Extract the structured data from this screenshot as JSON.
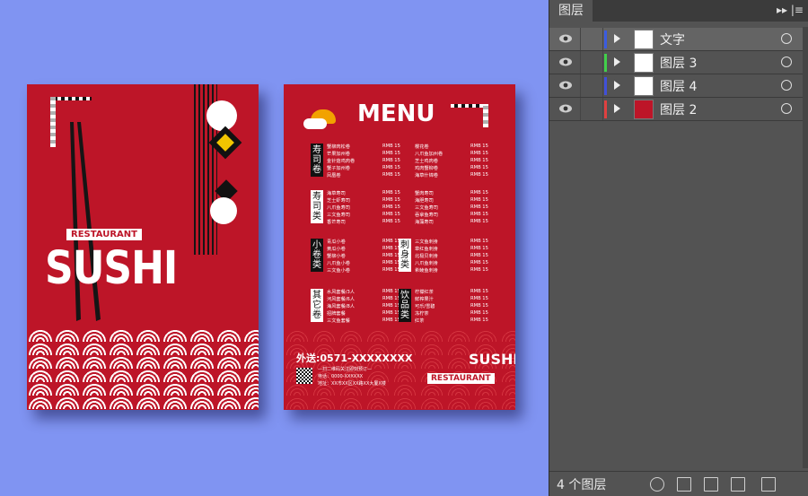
{
  "panel": {
    "tab_label": "图层",
    "menu_glyph": "▸▸ |≡",
    "layers": [
      {
        "name": "文字",
        "color": "#3a5be0",
        "selected": true
      },
      {
        "name": "图层 3",
        "color": "#42d04a",
        "selected": false
      },
      {
        "name": "图层 4",
        "color": "#4050d8",
        "selected": false
      },
      {
        "name": "图层 2",
        "color": "#e04040",
        "selected": false
      }
    ],
    "footer_count": "4 个图层",
    "footer_icons": [
      "search-icon",
      "make-clipping-mask-icon",
      "new-sublayer-icon",
      "new-layer-icon",
      "delete-icon"
    ]
  },
  "front": {
    "restaurant": "RESTAURANT",
    "sushi": "SUSHI"
  },
  "back": {
    "menu_title": "MENU",
    "categories": [
      "寿司卷",
      "寿司类",
      "小卷类",
      "其它卷",
      "刺身类",
      "饮品类"
    ],
    "col1": [
      [
        "蟹柳肉松卷",
        "RMB 15"
      ],
      [
        "芒果加州卷",
        "RMB 15"
      ],
      [
        "金针菇鸡肉卷",
        "RMB 15"
      ],
      [
        "蟹子加州卷",
        "RMB 15"
      ],
      [
        "凤凰卷",
        "RMB 15"
      ],
      [
        "海草寿司",
        "RMB 15"
      ],
      [
        "芝士虾寿司",
        "RMB 15"
      ],
      [
        "八爪鱼寿司",
        "RMB 15"
      ],
      [
        "三文鱼寿司",
        "RMB 15"
      ],
      [
        "香芒寿司",
        "RMB 15"
      ],
      [
        "青瓜小卷",
        "RMB 15"
      ],
      [
        "黄瓜小卷",
        "RMB 15"
      ],
      [
        "蟹柳小卷",
        "RMB 15"
      ],
      [
        "八爪鱼小卷",
        "RMB 15"
      ],
      [
        "三文鱼小卷",
        "RMB 15"
      ],
      [
        "水风套餐/3人",
        "RMB 15"
      ],
      [
        "河风套餐/6人",
        "RMB 15"
      ],
      [
        "海风套餐/8人",
        "RMB 15"
      ],
      [
        "招牌套餐",
        "RMB 15"
      ],
      [
        "三文鱼套餐",
        "RMB 15"
      ]
    ],
    "col2": [
      [
        "樱花卷",
        "RMB 15"
      ],
      [
        "八爪鱼加州卷",
        "RMB 15"
      ],
      [
        "芝士鸡肉卷",
        "RMB 15"
      ],
      [
        "鸡肉蟹柳卷",
        "RMB 15"
      ],
      [
        "海草什锦卷",
        "RMB 15"
      ],
      [
        "蟹肉寿司",
        "RMB 15"
      ],
      [
        "海胆寿司",
        "RMB 15"
      ],
      [
        "三文鱼寿司",
        "RMB 15"
      ],
      [
        "吞拿鱼寿司",
        "RMB 15"
      ],
      [
        "海藻寿司",
        "RMB 15"
      ],
      [
        "三文鱼刺身",
        "RMB 15"
      ],
      [
        "章红鱼刺身",
        "RMB 15"
      ],
      [
        "北极贝刺身",
        "RMB 15"
      ],
      [
        "八爪鱼刺身",
        "RMB 15"
      ],
      [
        "希鲮鱼刺身",
        "RMB 15"
      ],
      [
        "柠檬红茶",
        "RMB 15"
      ],
      [
        "鲜榨果汁",
        "RMB 15"
      ],
      [
        "可乐/雪碧",
        "RMB 15"
      ],
      [
        "冻柠茶",
        "RMB 15"
      ],
      [
        "红茶",
        "RMB 15"
      ]
    ],
    "delivery": "外送:0571-XXXXXXXX",
    "small1": "—扫二维码关注即刻预订—",
    "small2": "电话：0000-XXXXXX",
    "small3": "地址：XX市XX区XX路XX大厦X楼",
    "logo_sushi": "SUSHI",
    "logo_restaurant": "RESTAURANT"
  }
}
